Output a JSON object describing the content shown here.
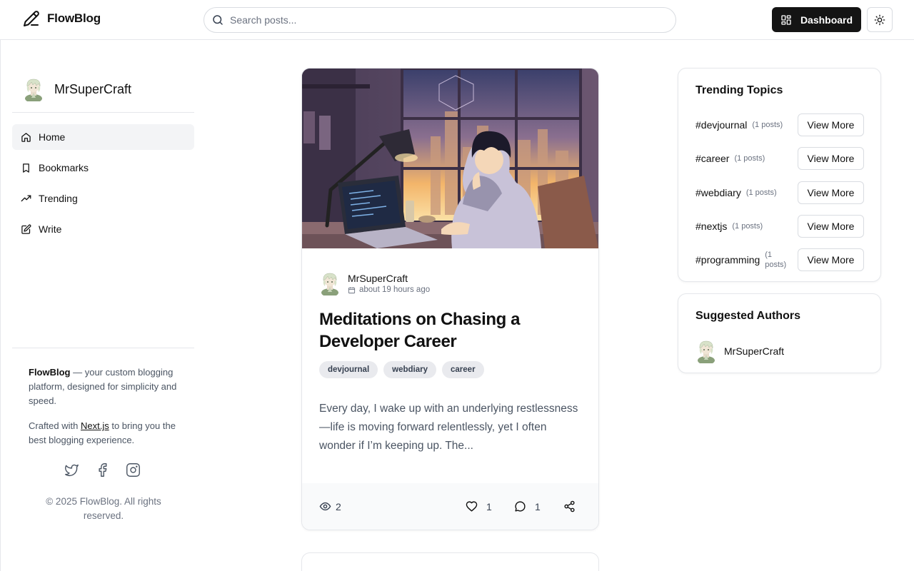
{
  "header": {
    "brand": "FlowBlog",
    "search_placeholder": "Search posts...",
    "dashboard_label": "Dashboard"
  },
  "sidebar": {
    "profile_name": "MrSuperCraft",
    "nav": [
      {
        "label": "Home",
        "icon": "home-icon",
        "active": true
      },
      {
        "label": "Bookmarks",
        "icon": "bookmark-icon",
        "active": false
      },
      {
        "label": "Trending",
        "icon": "trending-icon",
        "active": false
      },
      {
        "label": "Write",
        "icon": "write-icon",
        "active": false
      }
    ],
    "about_brand": "FlowBlog",
    "about_text": " — your custom blogging platform, designed for simplicity and speed.",
    "crafted_prefix": "Crafted with ",
    "crafted_link": "Next.js",
    "crafted_suffix": " to bring you the best blogging experience.",
    "copyright": "© 2025 FlowBlog. All rights reserved."
  },
  "post": {
    "author": "MrSuperCraft",
    "time": "about 19 hours ago",
    "title": "Meditations on Chasing a Developer Career",
    "tags": [
      "devjournal",
      "webdiary",
      "career"
    ],
    "excerpt": "Every day, I wake up with an underlying restlessness—life is moving forward relentlessly, yet I often wonder if I’m keeping up. The...",
    "views": "2",
    "likes": "1",
    "comments": "1"
  },
  "trending": {
    "title": "Trending Topics",
    "button_label": "View More",
    "topics": [
      {
        "name": "#devjournal",
        "count": "(1 posts)"
      },
      {
        "name": "#career",
        "count": "(1 posts)"
      },
      {
        "name": "#webdiary",
        "count": "(1 posts)"
      },
      {
        "name": "#nextjs",
        "count": "(1 posts)"
      },
      {
        "name": "#programming",
        "count": "(1 posts)"
      }
    ]
  },
  "suggested": {
    "title": "Suggested Authors",
    "authors": [
      "MrSuperCraft"
    ]
  },
  "colors": {
    "primary_button": "#141414",
    "border": "#e5e7eb",
    "active_nav_bg": "#f3f4f6",
    "tag_bg": "#e9eaee"
  }
}
